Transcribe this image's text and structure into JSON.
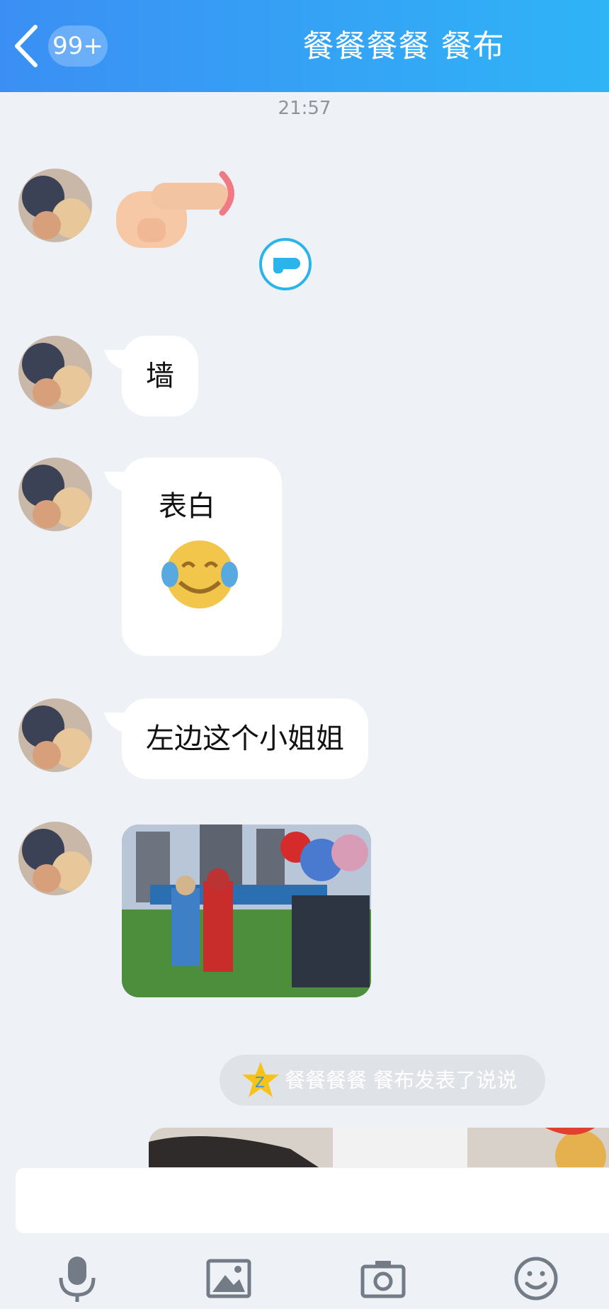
{
  "header": {
    "back_label": "<",
    "unread_badge": "99+",
    "title": "餐餐餐餐 餐布"
  },
  "chat": {
    "timestamp": "21:57",
    "messages": [
      {
        "type": "gesture",
        "content": "pointing-hand-emoji"
      },
      {
        "type": "text",
        "text": "墙"
      },
      {
        "type": "text_with_emoji",
        "text": "表白",
        "emoji": "crying-laughing-face-emoji"
      },
      {
        "type": "text",
        "text": "左边这个小姐姐"
      },
      {
        "type": "image",
        "description": "photo"
      }
    ],
    "system_notice": "餐餐餐餐 餐布发表了说说"
  },
  "input": {
    "placeholder": ""
  },
  "toolbar": {
    "icons": [
      "microphone-icon",
      "image-icon",
      "camera-icon",
      "emoji-icon"
    ]
  },
  "colors": {
    "header_start": "#3b8ff4",
    "header_end": "#2fb4f6",
    "background": "#eef1f6",
    "bubble": "#ffffff"
  }
}
